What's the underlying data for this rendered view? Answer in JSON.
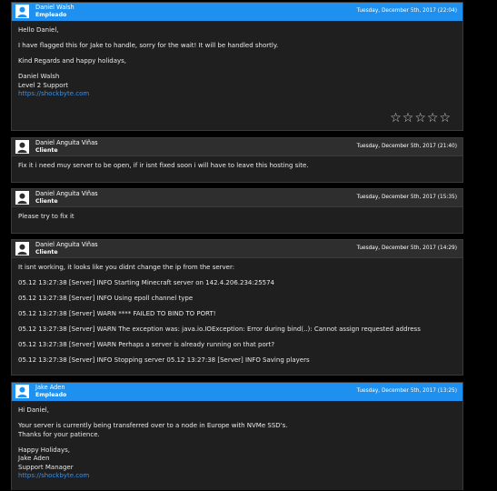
{
  "messages": [
    {
      "author": "Daniel Walsh",
      "role": "Empleado",
      "timestamp": "Tuesday, December 5th, 2017 (22:04)",
      "type": "staff",
      "lines": [
        "Hello Daniel,",
        "I have flagged this for Jake to handle, sorry for the wait! It will be handled shortly.",
        "Kind Regards and happy holidays,",
        "Daniel Walsh",
        "Level 2 Support",
        "https://shockbyte.com"
      ],
      "rating_stars": 5,
      "rating_glyphs": "☆☆☆☆☆"
    },
    {
      "author": "Daniel Anguita Viñas",
      "role": "Cliente",
      "timestamp": "Tuesday, December 5th, 2017 (21:40)",
      "type": "client",
      "lines": [
        "Fix it i need muy server to be open, if ir isnt fixed soon i will have to leave this hosting site."
      ]
    },
    {
      "author": "Daniel Anguita Viñas",
      "role": "Cliente",
      "timestamp": "Tuesday, December 5th, 2017 (15:35)",
      "type": "client",
      "lines": [
        "Please try to fix it"
      ]
    },
    {
      "author": "Daniel Anguita Viñas",
      "role": "Cliente",
      "timestamp": "Tuesday, December 5th, 2017 (14:29)",
      "type": "client",
      "lines": [
        "It isnt working, it looks like you didnt change the ip from the server:",
        "05.12 13:27:38 [Server] INFO Starting Minecraft server on 142.4.206.234:25574",
        "05.12 13:27:38 [Server] INFO Using epoll channel type",
        "05.12 13:27:38 [Server] WARN **** FAILED TO BIND TO PORT!",
        "05.12 13:27:38 [Server] WARN The exception was: java.io.IOException: Error during bind(..): Cannot assign requested address",
        "05.12 13:27:38 [Server] WARN Perhaps a server is already running on that port?",
        "05.12 13:27:38 [Server] INFO Stopping server 05.12 13:27:38 [Server] INFO Saving players"
      ]
    },
    {
      "author": "Jake Aden",
      "role": "Empleado",
      "timestamp": "Tuesday, December 5th, 2017 (13:25)",
      "type": "staff",
      "lines": [
        "Hi Daniel,",
        "Your server is currently being transferred over to a node in Europe with NVMe SSD's.",
        "Thanks for your patience.",
        "Happy Holidays,",
        "Jake Aden",
        "Support Manager",
        "https://shockbyte.com"
      ]
    }
  ],
  "colors": {
    "staff_header": "#1e90ef",
    "client_header": "#2e2e2e",
    "card_bg": "#1f1f1f",
    "link": "#3d8fe6"
  },
  "icons": {
    "avatar": "user-icon",
    "rating": "star-outline-icon"
  }
}
